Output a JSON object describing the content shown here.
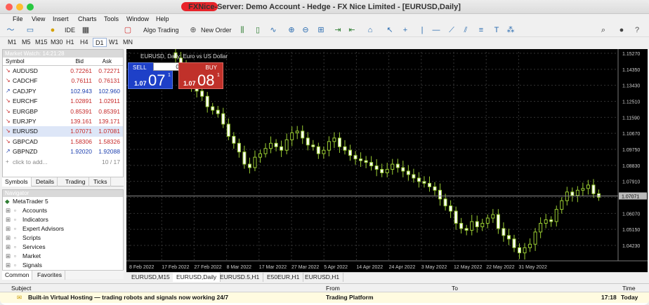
{
  "window": {
    "title": "FXNice-Server: Demo Account - Hedge - FX Nice Limited - [EURUSD,Daily]"
  },
  "menu": [
    "File",
    "View",
    "Insert",
    "Charts",
    "Tools",
    "Window",
    "Help"
  ],
  "toolbar": {
    "ide": "IDE",
    "algo": "Algo Trading",
    "neworder": "New Order"
  },
  "timeframes": [
    "M1",
    "M5",
    "M15",
    "M30",
    "H1",
    "H4",
    "D1",
    "W1",
    "MN"
  ],
  "active_tf": "D1",
  "market_watch": {
    "header": "Market Watch: 14:21:28",
    "col_symbol": "Symbol",
    "col_bid": "Bid",
    "col_ask": "Ask",
    "rows": [
      {
        "symbol": "AUDUSD",
        "bid": "0.72261",
        "ask": "0.72271",
        "dir": "down"
      },
      {
        "symbol": "CADCHF",
        "bid": "0.76111",
        "ask": "0.76131",
        "dir": "down"
      },
      {
        "symbol": "CADJPY",
        "bid": "102.943",
        "ask": "102.960",
        "dir": "up"
      },
      {
        "symbol": "EURCHF",
        "bid": "1.02891",
        "ask": "1.02911",
        "dir": "down"
      },
      {
        "symbol": "EURGBP",
        "bid": "0.85391",
        "ask": "0.85391",
        "dir": "down"
      },
      {
        "symbol": "EURJPY",
        "bid": "139.161",
        "ask": "139.171",
        "dir": "down"
      },
      {
        "symbol": "EURUSD",
        "bid": "1.07071",
        "ask": "1.07081",
        "dir": "down"
      },
      {
        "symbol": "GBPCAD",
        "bid": "1.58306",
        "ask": "1.58326",
        "dir": "down"
      },
      {
        "symbol": "GBPNZD",
        "bid": "1.92020",
        "ask": "1.92088",
        "dir": "up"
      }
    ],
    "add": "click to add...",
    "count": "10 / 17",
    "tabs": [
      "Symbols",
      "Details",
      "Trading",
      "Ticks"
    ]
  },
  "navigator": {
    "header": "Navigator",
    "root": "MetaTrader 5",
    "items": [
      "Accounts",
      "Indicators",
      "Expert Advisors",
      "Scripts",
      "Services",
      "Market",
      "Signals"
    ],
    "tabs": [
      "Common",
      "Favorites"
    ]
  },
  "chart": {
    "label": "EURUSD, Daily: Euro vs US Dollar",
    "sell": "SELL",
    "buy": "BUY",
    "lot": "0.01",
    "sell_small": "1.07",
    "sell_big": "07",
    "sell_sup": "1",
    "buy_small": "1.07",
    "buy_big": "08",
    "buy_sup": "1",
    "price_label": "1.07071",
    "current_price": 1.07071,
    "yticks": [
      "1.15270",
      "1.14350",
      "1.13430",
      "1.12510",
      "1.11590",
      "1.10670",
      "1.09750",
      "1.08830",
      "1.07910",
      "1.06990",
      "1.06070",
      "1.05150",
      "1.04230"
    ],
    "xticks": [
      "8 Feb 2022",
      "17 Feb 2022",
      "27 Feb 2022",
      "8 Mar 2022",
      "17 Mar 2022",
      "27 Mar 2022",
      "5 Apr 2022",
      "14 Apr 2022",
      "24 Apr 2022",
      "3 May 2022",
      "12 May 2022",
      "22 May 2022",
      "31 May 2022"
    ]
  },
  "chart_tabs": [
    "EURUSD,M15",
    "EURUSD,Daily",
    "EURUSD.5,H1",
    "E50EUR,H1",
    "EURUSD,H1"
  ],
  "toolbox": {
    "col_subject": "Subject",
    "col_from": "From",
    "col_to": "To",
    "col_time": "Time",
    "subject": "Built-in Virtual Hosting — trading robots and signals now working 24/7",
    "from": "Trading Platform",
    "time": "17:18",
    "today": "Today"
  }
}
